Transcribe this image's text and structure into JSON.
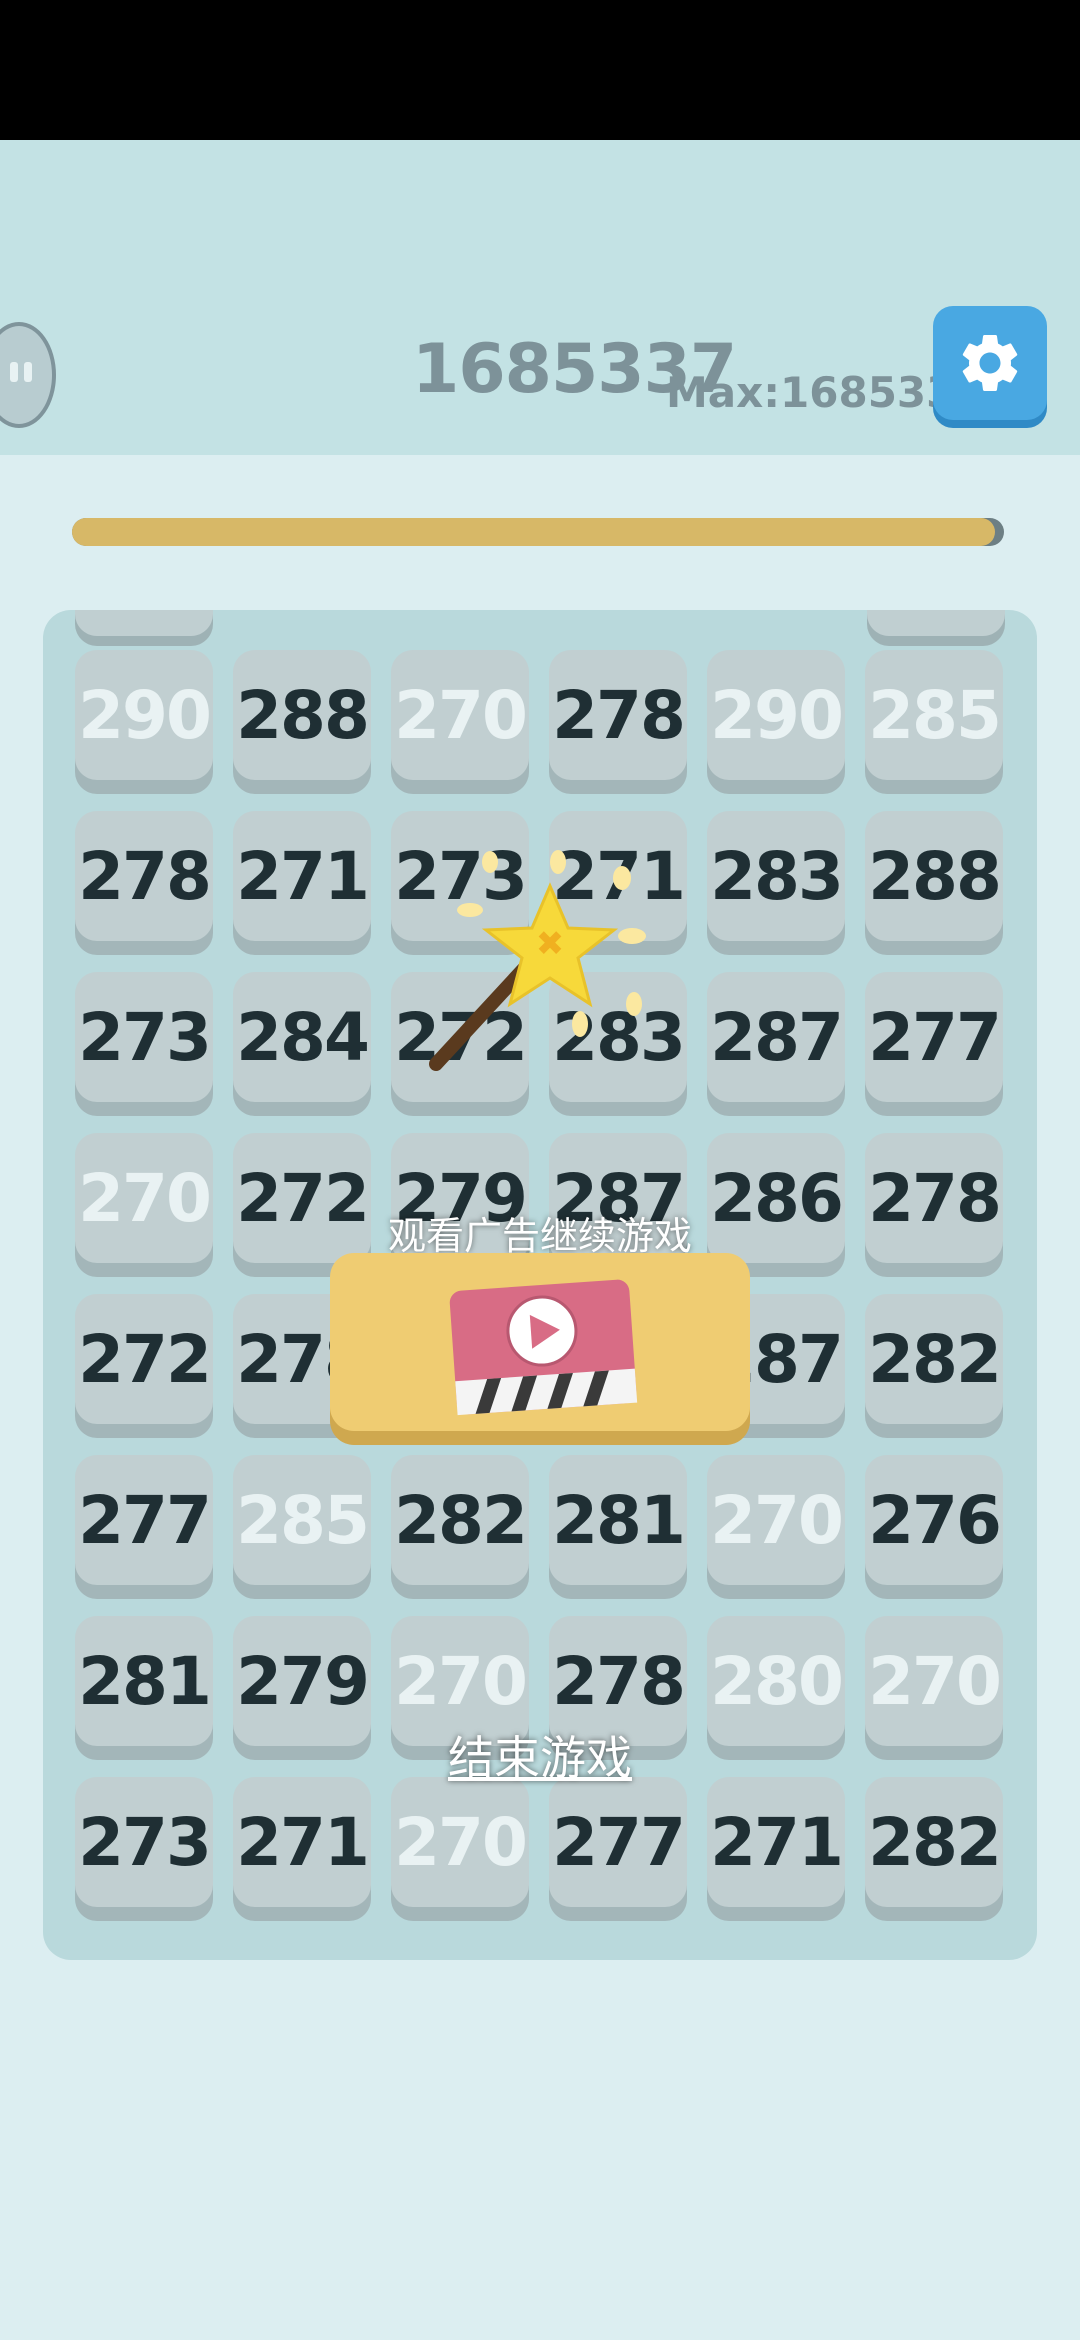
{
  "header": {
    "score": "1685337",
    "max_score": "Max:1685337"
  },
  "progress": {
    "fraction": 0.99
  },
  "board": {
    "rows": [
      [
        {
          "v": "290",
          "s": "light"
        },
        {
          "v": "288",
          "s": "dark"
        },
        {
          "v": "270",
          "s": "light"
        },
        {
          "v": "278",
          "s": "dark"
        },
        {
          "v": "290",
          "s": "light"
        },
        {
          "v": "285",
          "s": "light"
        }
      ],
      [
        {
          "v": "278",
          "s": "dark"
        },
        {
          "v": "271",
          "s": "dark"
        },
        {
          "v": "273",
          "s": "dark"
        },
        {
          "v": "271",
          "s": "dark"
        },
        {
          "v": "283",
          "s": "dark"
        },
        {
          "v": "288",
          "s": "dark"
        }
      ],
      [
        {
          "v": "273",
          "s": "dark"
        },
        {
          "v": "284",
          "s": "dark"
        },
        {
          "v": "272",
          "s": "dark"
        },
        {
          "v": "283",
          "s": "dark"
        },
        {
          "v": "287",
          "s": "dark"
        },
        {
          "v": "277",
          "s": "dark"
        }
      ],
      [
        {
          "v": "270",
          "s": "light"
        },
        {
          "v": "272",
          "s": "dark"
        },
        {
          "v": "279",
          "s": "dark"
        },
        {
          "v": "287",
          "s": "dark"
        },
        {
          "v": "286",
          "s": "dark"
        },
        {
          "v": "278",
          "s": "dark"
        }
      ],
      [
        {
          "v": "272",
          "s": "dark"
        },
        {
          "v": "278",
          "s": "dark"
        },
        {
          "v": "",
          "s": "dark"
        },
        {
          "v": "",
          "s": "dark"
        },
        {
          "v": "287",
          "s": "dark"
        },
        {
          "v": "282",
          "s": "dark"
        }
      ],
      [
        {
          "v": "277",
          "s": "dark"
        },
        {
          "v": "285",
          "s": "light"
        },
        {
          "v": "282",
          "s": "dark"
        },
        {
          "v": "281",
          "s": "dark"
        },
        {
          "v": "270",
          "s": "light"
        },
        {
          "v": "276",
          "s": "dark"
        }
      ],
      [
        {
          "v": "281",
          "s": "dark"
        },
        {
          "v": "279",
          "s": "dark"
        },
        {
          "v": "270",
          "s": "light"
        },
        {
          "v": "278",
          "s": "dark"
        },
        {
          "v": "280",
          "s": "light"
        },
        {
          "v": "270",
          "s": "light"
        }
      ],
      [
        {
          "v": "273",
          "s": "dark"
        },
        {
          "v": "271",
          "s": "dark"
        },
        {
          "v": "270",
          "s": "light"
        },
        {
          "v": "277",
          "s": "dark"
        },
        {
          "v": "271",
          "s": "dark"
        },
        {
          "v": "282",
          "s": "dark"
        }
      ]
    ]
  },
  "overlay": {
    "ad_caption": "观看广告继续游戏",
    "end_game_label": "结束游戏"
  },
  "icons": {
    "settings": "gear-icon",
    "pause": "pause-icon",
    "wand": "magic-wand-icon",
    "video": "video-play-icon"
  },
  "colors": {
    "header_bg": "#c3e2e4",
    "board_bg": "#b9d9dc",
    "settings_blue": "#49a8e2",
    "progress_gold": "#d7b867",
    "ad_button": "#efcc72"
  }
}
